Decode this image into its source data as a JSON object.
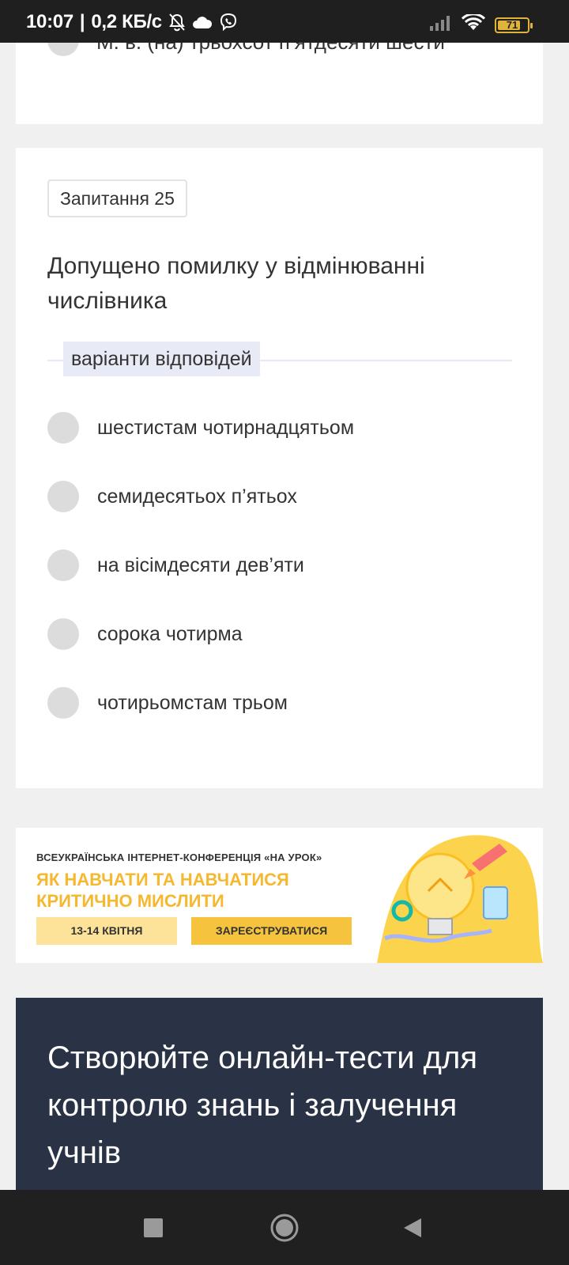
{
  "status_bar": {
    "time": "10:07",
    "separator": "|",
    "speed": "0,2 КБ/с",
    "battery_level": "71",
    "icons": [
      "bell-off-icon",
      "cloud-icon",
      "viber-icon",
      "signal-icon",
      "wifi-icon",
      "battery-icon"
    ]
  },
  "previous_question": {
    "partial_option": "М. в. (на) трьохсот п’ятдесяти шести"
  },
  "question": {
    "badge": "Запитання 25",
    "text": "Допущено помилку у відмінюванні числівника",
    "variants_label": "варіанти відповідей",
    "options": [
      "шестистам чотирнадцятьом",
      "семидесятьох п’ятьох",
      "на вісімдесяти дев’яти",
      "сорока чотирма",
      "чотирьомстам трьом"
    ]
  },
  "banner": {
    "kicker": "ВСЕУКРАЇНСЬКА ІНТЕРНЕТ-КОНФЕРЕНЦІЯ «НА УРОК»",
    "title_line1": "ЯК НАВЧАТИ ТА НАВЧАТИСЯ",
    "title_line2": "КРИТИЧНО МИСЛИТИ",
    "date": "13-14 КВІТНЯ",
    "register": "ЗАРЕЄСТРУВАТИСЯ",
    "colors": {
      "accent": "#f5b82e",
      "date_bg": "#fde39a",
      "button_bg": "#f5c33e"
    }
  },
  "promo": {
    "title": "Створюйте онлайн-тести для контролю знань і залучення учнів"
  },
  "nav": {
    "icons": [
      "recent-apps-icon",
      "home-icon",
      "back-icon"
    ]
  }
}
